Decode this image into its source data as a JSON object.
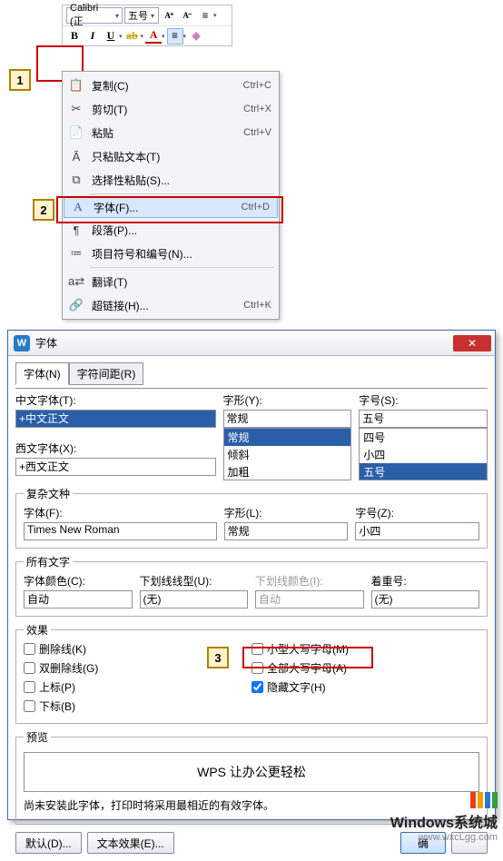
{
  "toolbar": {
    "font": "Calibri (正",
    "size": "五号",
    "buttons": {
      "Ap": "A⁺",
      "Am": "A⁻",
      "ls": "≡",
      "B": "B",
      "I": "I",
      "U": "U",
      "hi": "ab",
      "A": "A",
      "al": "≡",
      "er": "◆"
    }
  },
  "context": {
    "items": [
      {
        "icon": "📋",
        "label": "复制(C)",
        "sc": "Ctrl+C"
      },
      {
        "icon": "✂",
        "label": "剪切(T)",
        "sc": "Ctrl+X"
      },
      {
        "icon": "📄",
        "label": "粘贴",
        "sc": "Ctrl+V"
      },
      {
        "icon": "Ă",
        "label": "只粘贴文本(T)",
        "sc": ""
      },
      {
        "icon": "⧉",
        "label": "选择性粘贴(S)...",
        "sc": ""
      },
      {
        "icon": "A",
        "label": "字体(F)...",
        "sc": "Ctrl+D"
      },
      {
        "icon": "¶",
        "label": "段落(P)...",
        "sc": ""
      },
      {
        "icon": "≔",
        "label": "项目符号和编号(N)...",
        "sc": ""
      },
      {
        "icon": "a⇄",
        "label": "翻译(T)",
        "sc": ""
      },
      {
        "icon": "🔗",
        "label": "超链接(H)...",
        "sc": "Ctrl+K"
      }
    ]
  },
  "dialog": {
    "title": "字体",
    "tabs": {
      "font": "字体(N)",
      "spacing": "字符间距(R)"
    },
    "cn": {
      "lbl": "中文字体(T):",
      "val": "+中文正文"
    },
    "style": {
      "lbl": "字形(Y):",
      "val": "常规",
      "opts": [
        "常规",
        "倾斜",
        "加粗"
      ]
    },
    "size": {
      "lbl": "字号(S):",
      "val": "五号",
      "opts": [
        "四号",
        "小四",
        "五号"
      ]
    },
    "west": {
      "lbl": "西文字体(X):",
      "val": "+西文正文"
    },
    "complex": {
      "legend": "复杂文种",
      "font_lbl": "字体(F):",
      "font_val": "Times New Roman",
      "style_lbl": "字形(L):",
      "style_val": "常规",
      "size_lbl": "字号(Z):",
      "size_val": "小四"
    },
    "all": {
      "legend": "所有文字",
      "color_lbl": "字体颜色(C):",
      "color_val": "自动",
      "ul_lbl": "下划线线型(U):",
      "ul_val": "(无)",
      "ulc_lbl": "下划线颜色(I):",
      "ulc_val": "自动",
      "emph_lbl": "着重号:",
      "emph_val": "(无)"
    },
    "effects": {
      "legend": "效果",
      "strike": "删除线(K)",
      "dstrike": "双删除线(G)",
      "sup": "上标(P)",
      "sub": "下标(B)",
      "smallcap": "小型大写字母(M)",
      "allcap": "全部大写字母(A)",
      "hidden": "隐藏文字(H)"
    },
    "preview": {
      "legend": "预览",
      "text": "WPS 让办公更轻松"
    },
    "note": "尚未安装此字体，打印时将采用最相近的有效字体。",
    "btns": {
      "default": "默认(D)...",
      "txteff": "文本效果(E)...",
      "ok": "确",
      "cancel": ""
    }
  },
  "steps": {
    "1": "1",
    "2": "2",
    "3": "3"
  },
  "watermark": {
    "title": "Windows系统城",
    "url": "www.wxcLgg.com"
  }
}
